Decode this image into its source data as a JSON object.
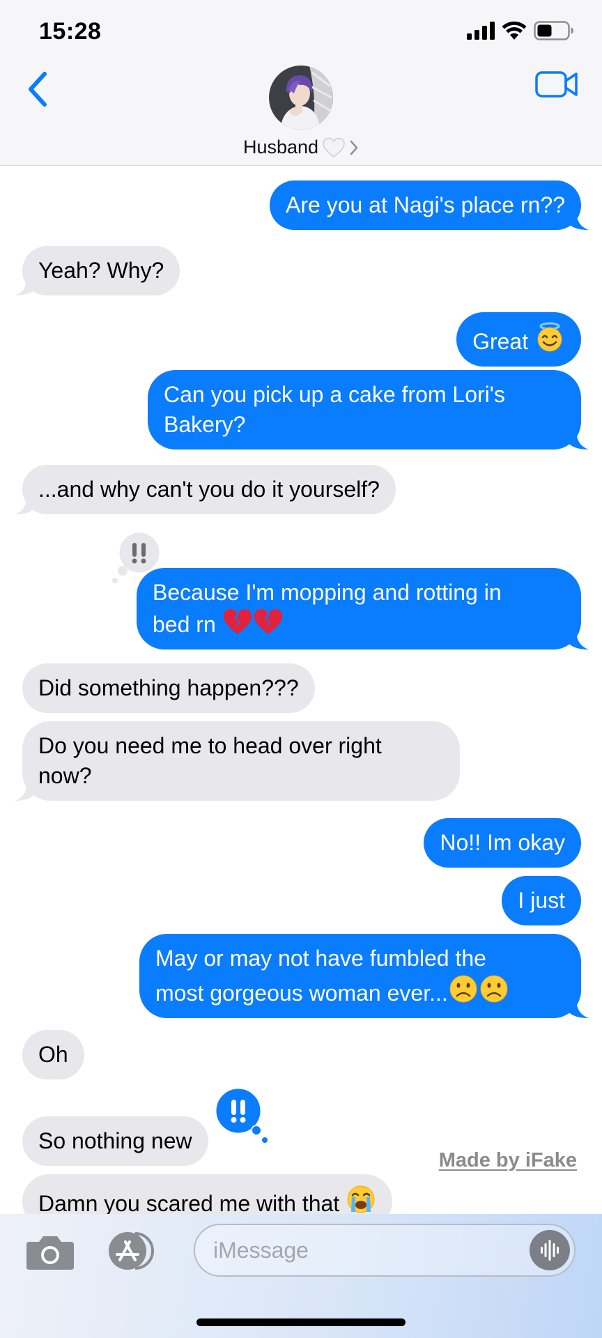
{
  "status_bar": {
    "time": "15:28"
  },
  "header": {
    "contact_name": "Husband"
  },
  "messages": [
    {
      "from": "me",
      "text": "Are you at Nagi's place rn??"
    },
    {
      "from": "them",
      "text": "Yeah? Why?"
    },
    {
      "from": "me",
      "text": "Great",
      "emoji": [
        "smiling-face-with-halo"
      ]
    },
    {
      "from": "me",
      "line1": "Can you pick up a cake from Lori's",
      "line2": "Bakery?"
    },
    {
      "from": "them",
      "text": "...and why can't you do it yourself?"
    },
    {
      "from": "me",
      "line1": "Because I'm mopping and rotting in",
      "line2": "bed rn",
      "emoji": [
        "broken-heart",
        "broken-heart"
      ],
      "reaction": "exclamation"
    },
    {
      "from": "them",
      "text": "Did something happen???"
    },
    {
      "from": "them",
      "line1": "Do you need me to head over right",
      "line2": "now?"
    },
    {
      "from": "me",
      "text": "No!! Im okay"
    },
    {
      "from": "me",
      "text": "I just"
    },
    {
      "from": "me",
      "line1": "May or may not have fumbled the",
      "line2": "most gorgeous woman ever...",
      "emoji": [
        "frowning-face",
        "frowning-face"
      ]
    },
    {
      "from": "them",
      "text": "Oh"
    },
    {
      "from": "them",
      "text": "So nothing new",
      "reaction": "exclamation"
    },
    {
      "from": "them",
      "text": "Damn you scared me with that",
      "emoji": [
        "loudly-crying-face"
      ]
    }
  ],
  "watermark": "Made by iFake",
  "composer": {
    "placeholder": "iMessage"
  },
  "colors": {
    "sent_bubble": "#0a7cfe",
    "received_bubble": "#e8e8ec",
    "accent": "#0a7cfe"
  }
}
